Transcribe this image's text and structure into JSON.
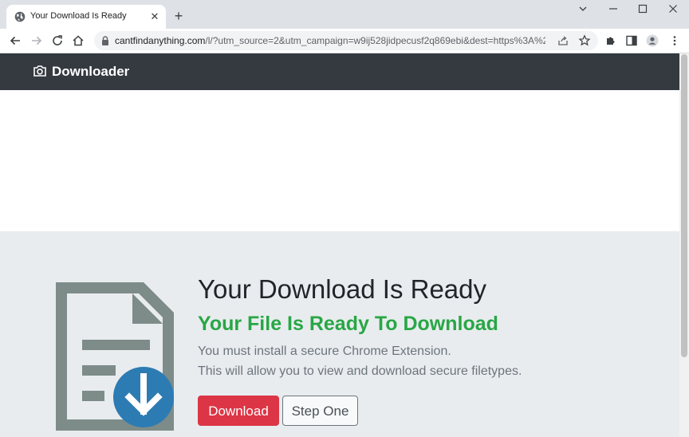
{
  "browser": {
    "tab": {
      "title": "Your Download Is Ready"
    },
    "url": {
      "host": "cantfindanything.com",
      "path": "/l/?utm_source=2&utm_campaign=w9ij528jidpecusf2q869ebi&dest=https%3A%2F..."
    }
  },
  "navbar": {
    "brand": "Downloader"
  },
  "hero": {
    "title": "Your Download Is Ready",
    "subtitle": "Your File Is Ready To Download",
    "lines": [
      "You must install a secure Chrome Extension.",
      "This will allow you to view and download secure filetypes."
    ],
    "download_button": "Download",
    "step_button": "Step One"
  },
  "colors": {
    "navbar": "#343a40",
    "hero_bg": "#e9ecef",
    "subtitle_green": "#28a745",
    "download_red": "#dc3545",
    "doc_gray": "#7d8c89",
    "download_badge_blue": "#2d7bb3"
  },
  "icons": [
    "globe-icon",
    "close-icon",
    "plus-icon",
    "chevron-down-icon",
    "minimize-icon",
    "maximize-icon",
    "window-close-icon",
    "back-icon",
    "forward-icon",
    "reload-icon",
    "home-icon",
    "lock-icon",
    "share-icon",
    "star-icon",
    "extensions-icon",
    "side-panel-icon",
    "profile-icon",
    "more-menu-icon",
    "camera-icon",
    "document-download-icon"
  ]
}
